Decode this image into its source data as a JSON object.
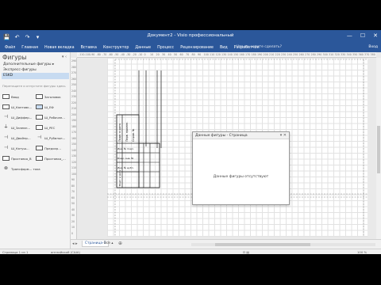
{
  "title_bar": {
    "quick_access": [
      "💾",
      "↶",
      "↷",
      "▾"
    ],
    "title": "Документ2 - Visio профессиональный",
    "window_controls": [
      "—",
      "☐",
      "✕"
    ]
  },
  "ribbon": {
    "tabs": [
      "Файл",
      "Главная",
      "Новая вкладка",
      "Вставка",
      "Конструктор",
      "Данные",
      "Процесс",
      "Рецензирование",
      "Вид",
      "Разработчик"
    ],
    "tell_me": "Что вы хотите сделать?",
    "user": "Вход"
  },
  "shapes_panel": {
    "header": "Фигуры",
    "header_controls": "▾ ‹",
    "more_shapes": "Дополнительные фигуры ▸",
    "quick_shapes": "Экспресс-фигуры",
    "stencil": "ESKD",
    "hint": "Перетащите и отпустите фигуры здесь",
    "items": [
      {
        "label": "Ввод",
        "symbol": "▭"
      },
      {
        "label": "Заголовок",
        "symbol": "▭"
      },
      {
        "label": "Ш_Кантовк…",
        "symbol": "▭"
      },
      {
        "label": "Ш_ЕФ",
        "symbol": "▭",
        "selected": true
      },
      {
        "label": "Ш_Диффер…",
        "symbol": "⊣"
      },
      {
        "label": "Ш_Рабочее…",
        "symbol": "▭"
      },
      {
        "label": "Ш_Заземл…",
        "symbol": "⏚"
      },
      {
        "label": "Ш_PEC",
        "symbol": "▭"
      },
      {
        "label": "Ш_Двойнр…",
        "symbol": "⊣"
      },
      {
        "label": "Ш_Рубильн…",
        "symbol": "⊣"
      },
      {
        "label": "Ш_Катуш…",
        "symbol": "⊣"
      },
      {
        "label": "Предохр…",
        "symbol": "▭"
      },
      {
        "label": "Проставка_В",
        "symbol": "▭"
      },
      {
        "label": "Проставка_…",
        "symbol": "▭"
      },
      {
        "label": "Трансформ… тока",
        "symbol": "⊗"
      }
    ]
  },
  "canvas": {
    "hruler_labels": [
      "-110",
      "-100",
      "-90",
      "-80",
      "-70",
      "-60",
      "-50",
      "-40",
      "-30",
      "-20",
      "-10",
      "0",
      "10",
      "20",
      "30",
      "40",
      "50",
      "60",
      "70",
      "80",
      "90",
      "100",
      "110",
      "120",
      "130",
      "140",
      "150",
      "160",
      "170",
      "180",
      "190",
      "200",
      "210",
      "220",
      "230",
      "240",
      "250",
      "260",
      "270",
      "280",
      "290",
      "300",
      "310",
      "320",
      "330",
      "340",
      "350",
      "360",
      "370",
      "380"
    ],
    "vruler_labels": [
      "290",
      "280",
      "270",
      "260",
      "250",
      "240",
      "230",
      "220",
      "210",
      "200",
      "190",
      "180",
      "170",
      "160",
      "150",
      "140",
      "130",
      "120",
      "110",
      "100",
      "90",
      "80",
      "70",
      "60",
      "50",
      "40",
      "30",
      "20",
      "10",
      "0"
    ],
    "stamp_cells": [
      "Подп. и дата",
      "Инв. № подл.",
      "Взам. инв. №",
      "Инв. № дубл.",
      "Подп. и дата"
    ],
    "stamp_side": "Перв. примен.",
    "stamp_ref": "Справ. №"
  },
  "shape_data_window": {
    "title": "Данные фигуры - Страница",
    "controls": "▾ ✕",
    "message": "Данные фигуры отсутствуют"
  },
  "page_tabs": {
    "nav": "◂ ▸",
    "current": "Страница-1",
    "all": "Все ▴",
    "add": "⊕"
  },
  "status_bar": {
    "page": "Страница 1 из 1",
    "language": "английский (США)",
    "zoom": "100 %",
    "fit_icons": "⊡ ▤"
  }
}
